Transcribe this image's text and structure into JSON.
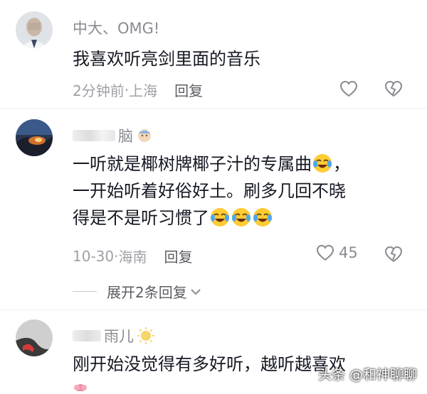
{
  "comments": [
    {
      "username": "中大、OMG!",
      "text": "我喜欢听亮剑里面的音乐",
      "time": "2分钟前",
      "location": "上海",
      "reply": "回复",
      "likes": ""
    },
    {
      "username": "脑",
      "text_line1": "一听就是椰树牌椰子汁的专属曲",
      "text_line1_tail": "，",
      "text_line2": "一开始听着好俗好土。刷多几回不晓",
      "text_line3": "得是不是听习惯了",
      "time": "10-30",
      "location": "海南",
      "reply": "回复",
      "likes": "45",
      "expand_label": "展开2条回复"
    },
    {
      "username": "雨儿",
      "text": "刚开始没觉得有多好听，越听越喜欢",
      "time": "",
      "location": ""
    }
  ],
  "separator": " · ",
  "watermark": "头条 @和神聊聊",
  "icons": {
    "like": "heart-outline-icon",
    "dislike": "broken-heart-icon",
    "expand": "chevron-down-icon",
    "emoji": "laugh-cry-emoji-icon"
  },
  "colors": {
    "text": "#161823",
    "meta": "#9fa0a6",
    "username": "#8a8b91"
  }
}
